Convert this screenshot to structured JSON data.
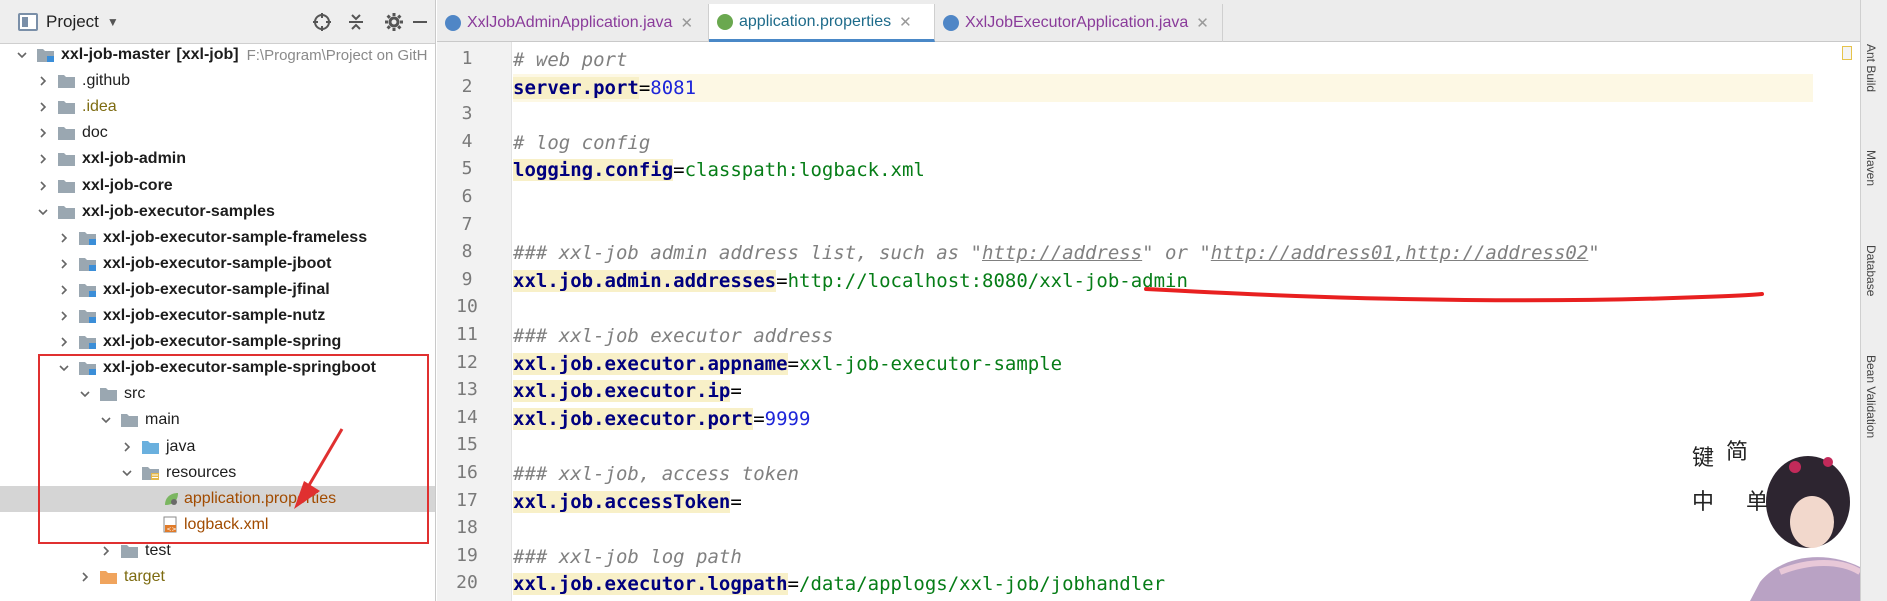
{
  "project_panel": {
    "title": "Project",
    "dropdown": "▼",
    "tree": [
      {
        "label": "xxl-job-master",
        "suffix": "[xxl-job]",
        "path": "F:\\Program\\Project on GitH",
        "depth": 0,
        "expanded": true
      },
      {
        "label": ".github",
        "depth": 1,
        "expanded": false
      },
      {
        "label": ".idea",
        "depth": 1,
        "expanded": false
      },
      {
        "label": "doc",
        "depth": 1,
        "expanded": false
      },
      {
        "label": "xxl-job-admin",
        "depth": 1,
        "expanded": false
      },
      {
        "label": "xxl-job-core",
        "depth": 1,
        "expanded": false
      },
      {
        "label": "xxl-job-executor-samples",
        "depth": 1,
        "expanded": true
      },
      {
        "label": "xxl-job-executor-sample-frameless",
        "depth": 2,
        "expanded": false
      },
      {
        "label": "xxl-job-executor-sample-jboot",
        "depth": 2,
        "expanded": false
      },
      {
        "label": "xxl-job-executor-sample-jfinal",
        "depth": 2,
        "expanded": false
      },
      {
        "label": "xxl-job-executor-sample-nutz",
        "depth": 2,
        "expanded": false
      },
      {
        "label": "xxl-job-executor-sample-spring",
        "depth": 2,
        "expanded": false
      },
      {
        "label": "xxl-job-executor-sample-springboot",
        "depth": 2,
        "expanded": true
      },
      {
        "label": "src",
        "depth": 3,
        "expanded": true
      },
      {
        "label": "main",
        "depth": 4,
        "expanded": true
      },
      {
        "label": "java",
        "depth": 5,
        "expanded": false
      },
      {
        "label": "resources",
        "depth": 5,
        "expanded": true
      },
      {
        "label": "application.properties",
        "depth": 6
      },
      {
        "label": "logback.xml",
        "depth": 6
      },
      {
        "label": "test",
        "depth": 4,
        "expanded": false
      },
      {
        "label": "target",
        "depth": 3,
        "expanded": false
      }
    ]
  },
  "tabs": [
    {
      "label": "XxlJobAdminApplication.java",
      "active": false
    },
    {
      "label": "application.properties",
      "active": true
    },
    {
      "label": "XxlJobExecutorApplication.java",
      "active": false
    }
  ],
  "editor": {
    "line_numbers": [
      "1",
      "2",
      "3",
      "4",
      "5",
      "6",
      "7",
      "8",
      "9",
      "10",
      "11",
      "12",
      "13",
      "14",
      "15",
      "16",
      "17",
      "18",
      "19",
      "20"
    ],
    "lines": [
      {
        "comment": "# web port"
      },
      {
        "key": "server.port",
        "value": "8081",
        "value_kind": "number"
      },
      {},
      {
        "comment": "# log config"
      },
      {
        "key": "logging.config",
        "value": "classpath:logback.xml"
      },
      {},
      {},
      {
        "comment_parts": [
          "### xxl-job admin address list, such as \"",
          "http://address",
          "\" or \"",
          "http://address01,http://address02",
          "\""
        ]
      },
      {
        "key": "xxl.job.admin.addresses",
        "value": "http://localhost:8080/xxl-job-admin"
      },
      {},
      {
        "comment": "### xxl-job executor address"
      },
      {
        "key": "xxl.job.executor.appname",
        "value": "xxl-job-executor-sample"
      },
      {
        "key": "xxl.job.executor.ip",
        "value": ""
      },
      {
        "key": "xxl.job.executor.port",
        "value": "9999",
        "value_kind": "number"
      },
      {},
      {
        "comment": "### xxl-job, access token"
      },
      {
        "key": "xxl.job.accessToken",
        "value": ""
      },
      {},
      {
        "comment": "### xxl-job log path"
      },
      {
        "key": "xxl.job.executor.logpath",
        "value": "/data/applogs/xxl-job/jobhandler"
      }
    ]
  },
  "right_rail": [
    "Ant Build",
    "Maven",
    "Database",
    "Bean Validation"
  ],
  "watermark": {
    "chars": [
      "键",
      "中",
      "简",
      "单"
    ]
  },
  "colors": {
    "accent": "#4a88c7",
    "annotation_red": "#e03030",
    "selection": "#d5d5d5"
  }
}
